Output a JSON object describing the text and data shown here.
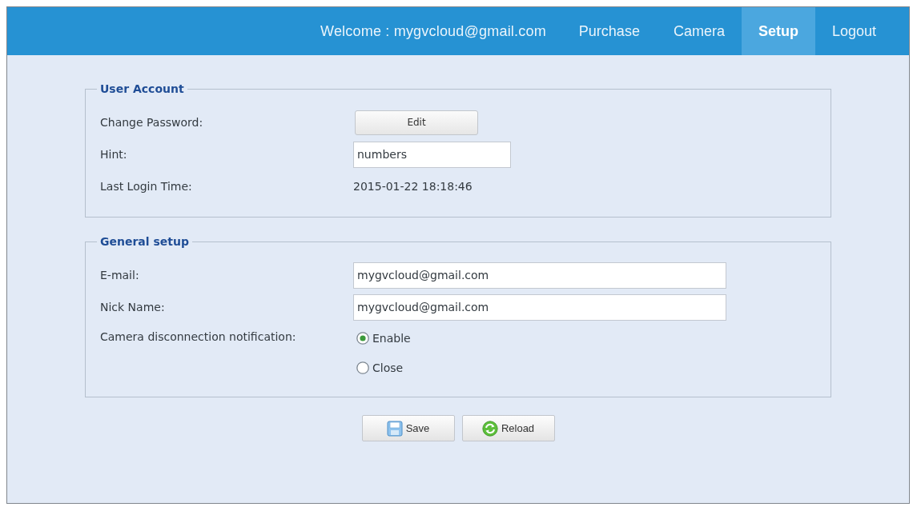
{
  "nav": {
    "welcome": "Welcome : mygvcloud@gmail.com",
    "items": [
      {
        "label": "Purchase",
        "selected": false
      },
      {
        "label": "Camera",
        "selected": false
      },
      {
        "label": "Setup",
        "selected": true
      },
      {
        "label": "Logout",
        "selected": false
      }
    ]
  },
  "sections": [
    {
      "legend": "User Account",
      "rows": [
        {
          "kind": "button",
          "label": "Change Password:",
          "button": "Edit"
        },
        {
          "kind": "input",
          "label": "Hint:",
          "value": "numbers"
        },
        {
          "kind": "text",
          "label": "Last Login Time:",
          "value": "2015-01-22 18:18:46"
        }
      ]
    },
    {
      "legend": "General setup",
      "rows": [
        {
          "kind": "wideinput",
          "label": "E-mail:",
          "value": "mygvcloud@gmail.com"
        },
        {
          "kind": "wideinput",
          "label": "Nick Name:",
          "value": "mygvcloud@gmail.com"
        },
        {
          "kind": "radio",
          "label": "Camera disconnection notification:",
          "options": [
            {
              "label": "Enable",
              "selected": true
            },
            {
              "label": "Close",
              "selected": false
            }
          ]
        }
      ]
    }
  ],
  "buttons": [
    {
      "kind": "save",
      "label": "Save"
    },
    {
      "kind": "reload",
      "label": "Reload"
    }
  ]
}
